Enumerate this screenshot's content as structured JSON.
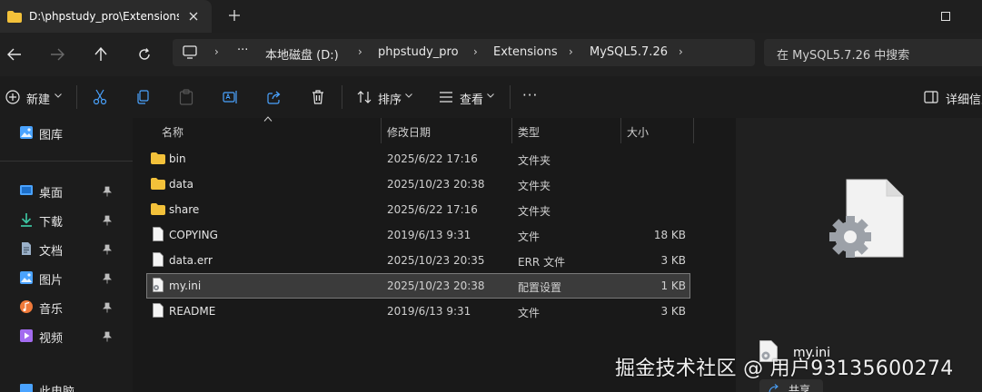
{
  "tab": {
    "title": "D:\\phpstudy_pro\\Extensions\\M"
  },
  "breadcrumb": {
    "items": [
      "本地磁盘 (D:)",
      "phpstudy_pro",
      "Extensions",
      "MySQL5.7.26"
    ],
    "more": "···"
  },
  "search": {
    "placeholder": "在 MySQL5.7.26 中搜索"
  },
  "commandbar": {
    "new_label": "新建",
    "sort_label": "排序",
    "view_label": "查看",
    "details_label": "详细信息",
    "more": "···"
  },
  "sidebar": {
    "top": {
      "label": "图库",
      "icon": "gallery-icon"
    },
    "items": [
      {
        "label": "桌面",
        "icon": "desktop-icon",
        "color": "#4aa3ff"
      },
      {
        "label": "下载",
        "icon": "download-icon",
        "color": "#3cc3a0"
      },
      {
        "label": "文档",
        "icon": "document-icon",
        "color": "#9ab0c8"
      },
      {
        "label": "图片",
        "icon": "picture-icon",
        "color": "#4aa3ff"
      },
      {
        "label": "音乐",
        "icon": "music-icon",
        "color": "#f07a3a"
      },
      {
        "label": "视频",
        "icon": "video-icon",
        "color": "#a36bf0"
      }
    ],
    "bottom": {
      "label": "此电脑"
    }
  },
  "columns": {
    "name": "名称",
    "date": "修改日期",
    "type": "类型",
    "size": "大小"
  },
  "files": [
    {
      "name": "bin",
      "date": "2025/6/22 17:16",
      "type": "文件夹",
      "size": "",
      "kind": "folder"
    },
    {
      "name": "data",
      "date": "2025/10/23 20:38",
      "type": "文件夹",
      "size": "",
      "kind": "folder"
    },
    {
      "name": "share",
      "date": "2025/6/22 17:16",
      "type": "文件夹",
      "size": "",
      "kind": "folder"
    },
    {
      "name": "COPYING",
      "date": "2019/6/13 9:31",
      "type": "文件",
      "size": "18 KB",
      "kind": "file"
    },
    {
      "name": "data.err",
      "date": "2025/10/23 20:35",
      "type": "ERR 文件",
      "size": "3 KB",
      "kind": "file"
    },
    {
      "name": "my.ini",
      "date": "2025/10/23 20:38",
      "type": "配置设置",
      "size": "1 KB",
      "kind": "ini",
      "selected": true
    },
    {
      "name": "README",
      "date": "2019/6/13 9:31",
      "type": "文件",
      "size": "3 KB",
      "kind": "file"
    }
  ],
  "preview": {
    "filename": "my.ini",
    "share_label": "共享"
  },
  "watermark": "掘金技术社区 @ 用户93135600274",
  "colors": {
    "folder": "#f3c13a",
    "accent": "#4aa3ff"
  }
}
